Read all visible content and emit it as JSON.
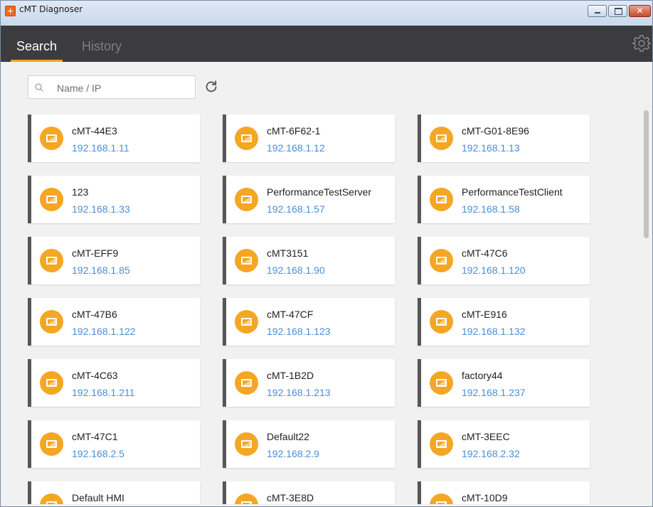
{
  "window": {
    "title": "cMT Diagnoser",
    "close_glyph": "✕"
  },
  "tabs": [
    {
      "label": "Search",
      "active": true
    },
    {
      "label": "History",
      "active": false
    }
  ],
  "search": {
    "placeholder": "Name / IP",
    "value": ""
  },
  "icons": {
    "search": "search-icon",
    "refresh": "refresh-icon",
    "settings": "gear-icon",
    "device": "hmi-device-icon"
  },
  "colors": {
    "accent": "#f5a623",
    "header": "#3c3c3e",
    "ip": "#4a8ed8",
    "card_bar": "#575757"
  },
  "devices": [
    {
      "name": "cMT-44E3",
      "ip": "192.168.1.11"
    },
    {
      "name": "cMT-6F62-1",
      "ip": "192.168.1.12"
    },
    {
      "name": "cMT-G01-8E96",
      "ip": "192.168.1.13"
    },
    {
      "name": "123",
      "ip": "192.168.1.33"
    },
    {
      "name": "PerformanceTestServer",
      "ip": "192.168.1.57"
    },
    {
      "name": "PerformanceTestClient",
      "ip": "192.168.1.58"
    },
    {
      "name": "cMT-EFF9",
      "ip": "192.168.1.85"
    },
    {
      "name": "cMT3151",
      "ip": "192.168.1.90"
    },
    {
      "name": "cMT-47C6",
      "ip": "192.168.1.120"
    },
    {
      "name": "cMT-47B6",
      "ip": "192.168.1.122"
    },
    {
      "name": "cMT-47CF",
      "ip": "192.168.1.123"
    },
    {
      "name": "cMT-E916",
      "ip": "192.168.1.132"
    },
    {
      "name": "cMT-4C63",
      "ip": "192.168.1.211"
    },
    {
      "name": "cMT-1B2D",
      "ip": "192.168.1.213"
    },
    {
      "name": "factory44",
      "ip": "192.168.1.237"
    },
    {
      "name": "cMT-47C1",
      "ip": "192.168.2.5"
    },
    {
      "name": "Default22",
      "ip": "192.168.2.9"
    },
    {
      "name": "cMT-3EEC",
      "ip": "192.168.2.32"
    },
    {
      "name": "Default HMI",
      "ip": ""
    },
    {
      "name": "cMT-3E8D",
      "ip": ""
    },
    {
      "name": "cMT-10D9",
      "ip": ""
    }
  ]
}
